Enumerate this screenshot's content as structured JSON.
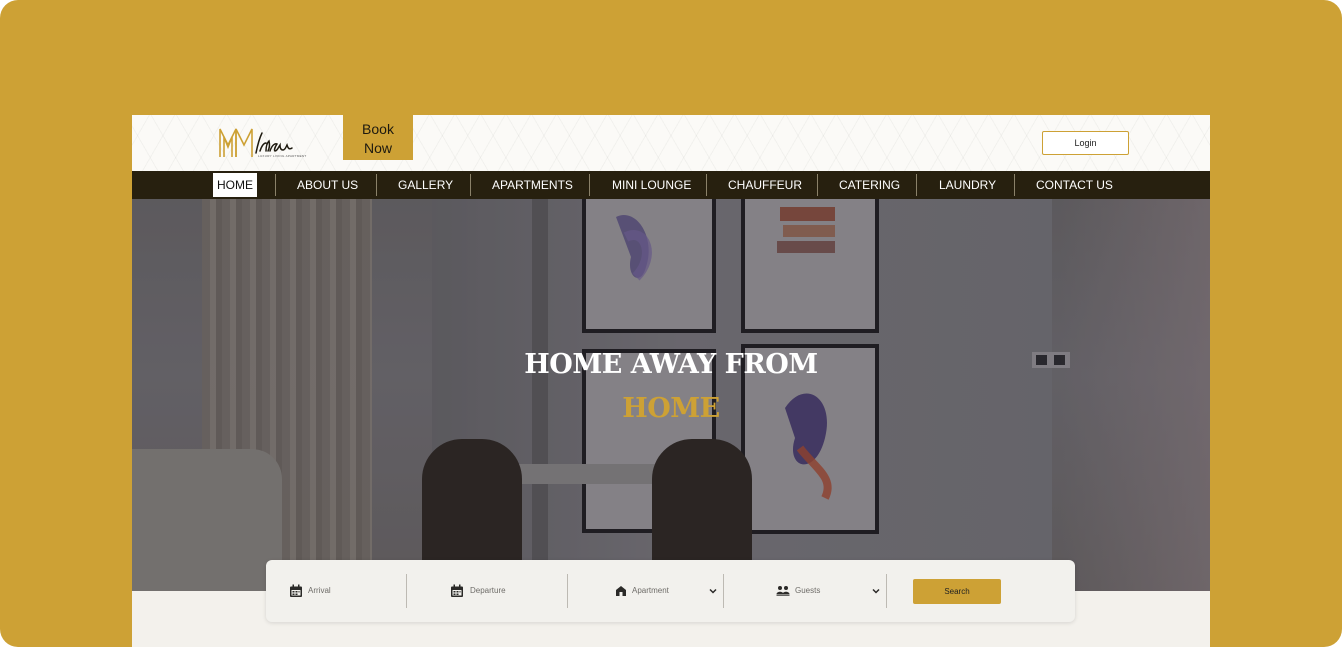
{
  "brand": {
    "name": "Milano",
    "tagline": "LUXURY LIVING APARTMENT"
  },
  "header": {
    "book_label": "Book\nNow",
    "login_label": "Login"
  },
  "nav": {
    "items": [
      "HOME",
      "ABOUT US",
      "GALLERY",
      "APARTMENTS",
      "MINI LOUNGE",
      "CHAUFFEUR",
      "CATERING",
      "LAUNDRY",
      "CONTACT US"
    ],
    "active": "HOME"
  },
  "hero": {
    "line1": "HOME AWAY FROM",
    "line2": "HOME"
  },
  "search": {
    "arrival_placeholder": "Arrival",
    "departure_placeholder": "Departure",
    "apartment_placeholder": "Apartment",
    "guests_placeholder": "Guests",
    "button_label": "Search"
  },
  "icons": {
    "arrival": "calendar-icon",
    "departure": "calendar-icon",
    "apartment": "building-icon",
    "guests": "people-icon",
    "dropdown": "chevron-down-icon"
  },
  "colors": {
    "accent": "#CDA135",
    "nav_bg": "#27200F",
    "page_bg": "#F3F1EC"
  }
}
